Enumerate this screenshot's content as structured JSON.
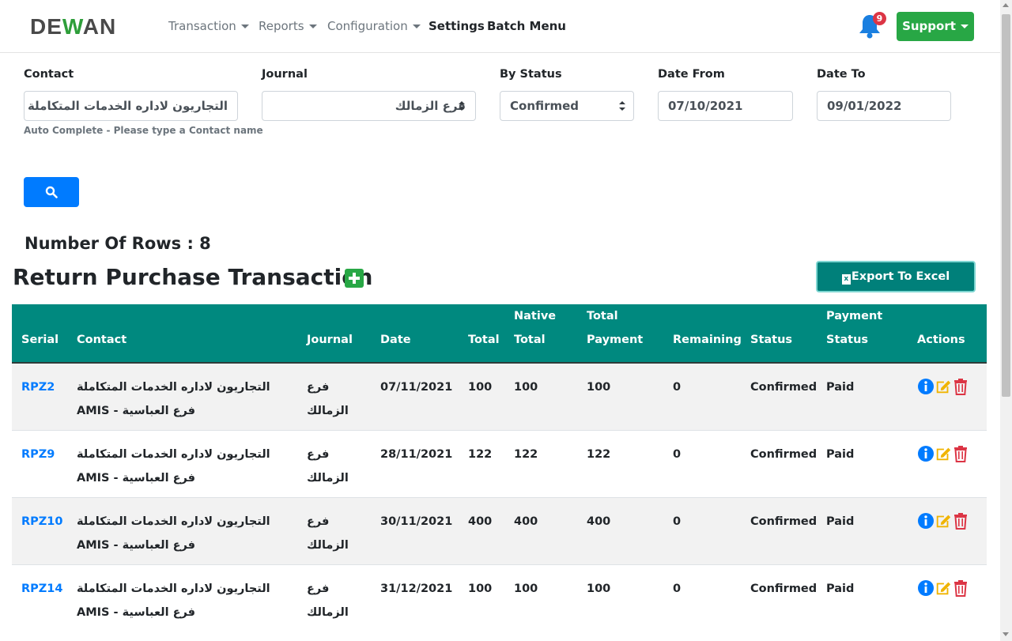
{
  "brand": {
    "prefix": "DE",
    "w": "W",
    "suffix": "AN"
  },
  "nav": {
    "transaction": "Transaction",
    "reports": "Reports",
    "configuration": "Configuration",
    "settings": "Settings",
    "batch_menu": "Batch Menu",
    "notifications_count": "9",
    "support": "Support"
  },
  "filters": {
    "contact_label": "Contact",
    "contact_value": "التجاريون لاداره الخدمات المتكاملة",
    "contact_help": "Auto Complete - Please type a Contact name",
    "journal_label": "Journal",
    "journal_value": "فرع الزمالك",
    "status_label": "By Status",
    "status_value": "Confirmed",
    "date_from_label": "Date From",
    "date_from_value": "07/10/2021",
    "date_to_label": "Date To",
    "date_to_value": "09/01/2022"
  },
  "rows_count_text": "Number Of Rows : 8",
  "page_title": "Return Purchase Transaction",
  "export_label": "Export To Excel",
  "table": {
    "headers": {
      "serial": "Serial",
      "contact": "Contact",
      "journal": "Journal",
      "date": "Date",
      "total": "Total",
      "native_total_1": "Native",
      "native_total_2": "Total",
      "total_payment_1": "Total",
      "total_payment_2": "Payment",
      "remaining": "Remaining",
      "status": "Status",
      "payment_status_1": "Payment",
      "payment_status_2": "Status",
      "actions": "Actions"
    },
    "rows": [
      {
        "serial": "RPZ2",
        "contact_1": "التجاريون لاداره الخدمات المتكاملة",
        "contact_2": "AMIS - فرع العباسية",
        "journal_1": "فرع",
        "journal_2": "الزمالك",
        "date": "07/11/2021",
        "total": "100",
        "native_total": "100",
        "total_payment": "100",
        "remaining": "0",
        "status": "Confirmed",
        "payment_status": "Paid"
      },
      {
        "serial": "RPZ9",
        "contact_1": "التجاريون لاداره الخدمات المتكاملة",
        "contact_2": "AMIS - فرع العباسية",
        "journal_1": "فرع",
        "journal_2": "الزمالك",
        "date": "28/11/2021",
        "total": "122",
        "native_total": "122",
        "total_payment": "122",
        "remaining": "0",
        "status": "Confirmed",
        "payment_status": "Paid"
      },
      {
        "serial": "RPZ10",
        "contact_1": "التجاريون لاداره الخدمات المتكاملة",
        "contact_2": "AMIS - فرع العباسية",
        "journal_1": "فرع",
        "journal_2": "الزمالك",
        "date": "30/11/2021",
        "total": "400",
        "native_total": "400",
        "total_payment": "400",
        "remaining": "0",
        "status": "Confirmed",
        "payment_status": "Paid"
      },
      {
        "serial": "RPZ14",
        "contact_1": "التجاريون لاداره الخدمات المتكاملة",
        "contact_2": "AMIS - فرع العباسية",
        "journal_1": "فرع",
        "journal_2": "الزمالك",
        "date": "31/12/2021",
        "total": "100",
        "native_total": "100",
        "total_payment": "100",
        "remaining": "0",
        "status": "Confirmed",
        "payment_status": "Paid"
      }
    ]
  },
  "icons": {
    "bell": "bell-icon",
    "search": "search-icon",
    "add": "plus-square-icon",
    "excel": "excel-icon",
    "info": "info-circle-icon",
    "edit": "edit-icon",
    "delete": "trash-icon"
  },
  "colors": {
    "brand_green": "#2e9e3a",
    "primary": "#007bff",
    "success": "#28a745",
    "teal_header": "#00897f",
    "edit": "#f0b400",
    "delete": "#dc3545"
  }
}
